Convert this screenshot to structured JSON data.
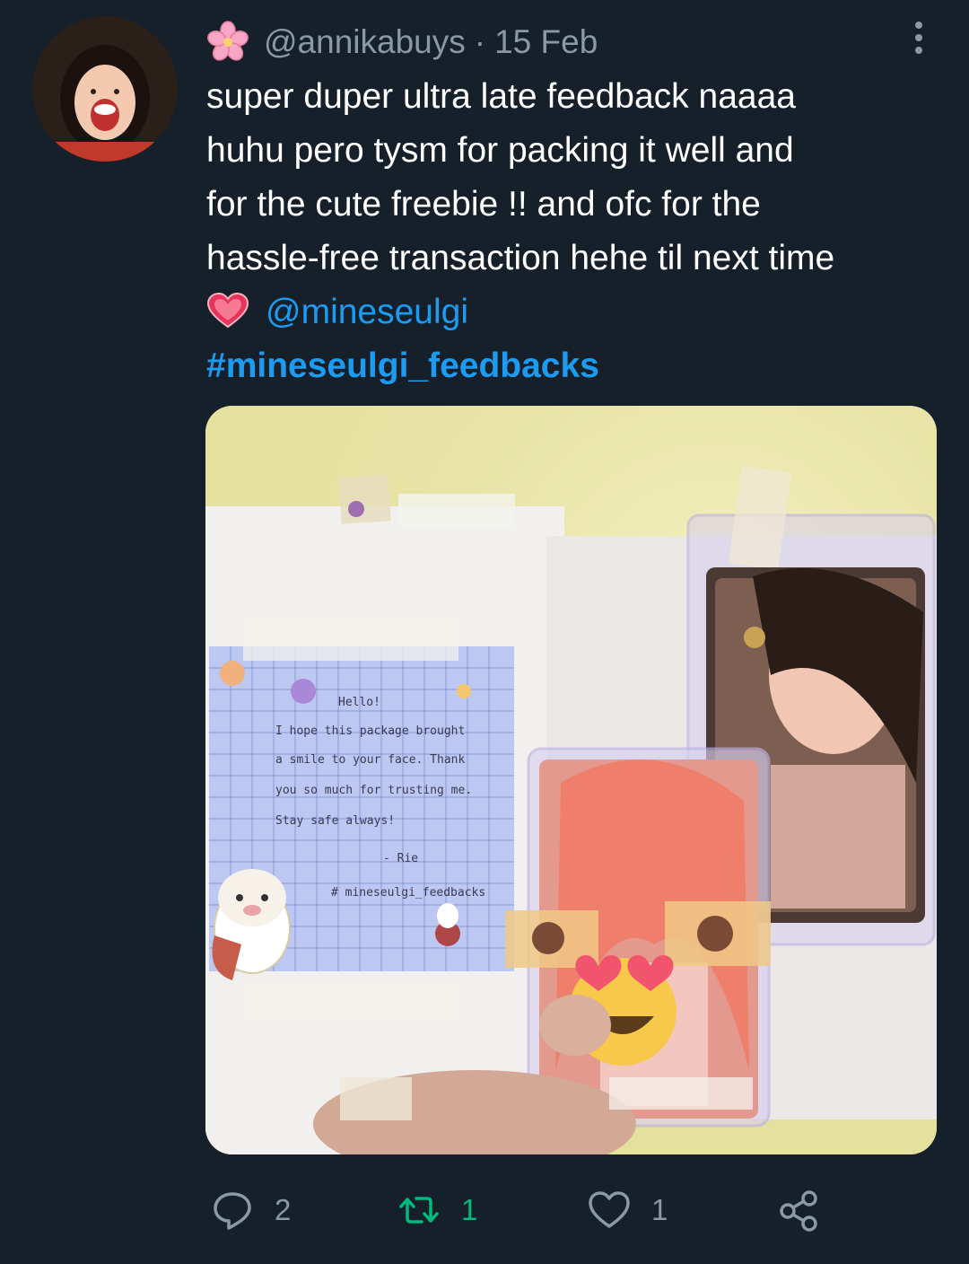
{
  "tweet": {
    "handle": "@annikabuys",
    "separator": "·",
    "date": "15 Feb",
    "text_lines": [
      "super duper ultra late feedback naaaa",
      "huhu pero tysm for packing it well and",
      "for the cute freebie !! and ofc for the",
      "hassle-free transaction hehe til next time"
    ],
    "mention": "@mineseulgi",
    "hashtag": "#mineseulgi_feedbacks",
    "photo_note": {
      "line1": "Hello!",
      "line2": "I hope this package brought",
      "line3": "a smile to your face. Thank",
      "line4": "you so much for trusting me.",
      "line5": "Stay safe always!",
      "line6": "- Rie",
      "line7": "# mineseulgi_feedbacks"
    }
  },
  "actions": {
    "reply_count": "2",
    "retweet_count": "1",
    "like_count": "1"
  },
  "colors": {
    "background": "#15202b",
    "link": "#1d9bf0",
    "muted": "#8b98a5",
    "retweet": "#00ba7c"
  },
  "icons": {
    "name_emoji": "cherry-blossom-icon",
    "menu": "more-vertical-icon",
    "heart_emoji": "heart-emoji-icon",
    "reply": "reply-icon",
    "retweet": "retweet-icon",
    "like": "like-icon",
    "share": "share-icon"
  }
}
